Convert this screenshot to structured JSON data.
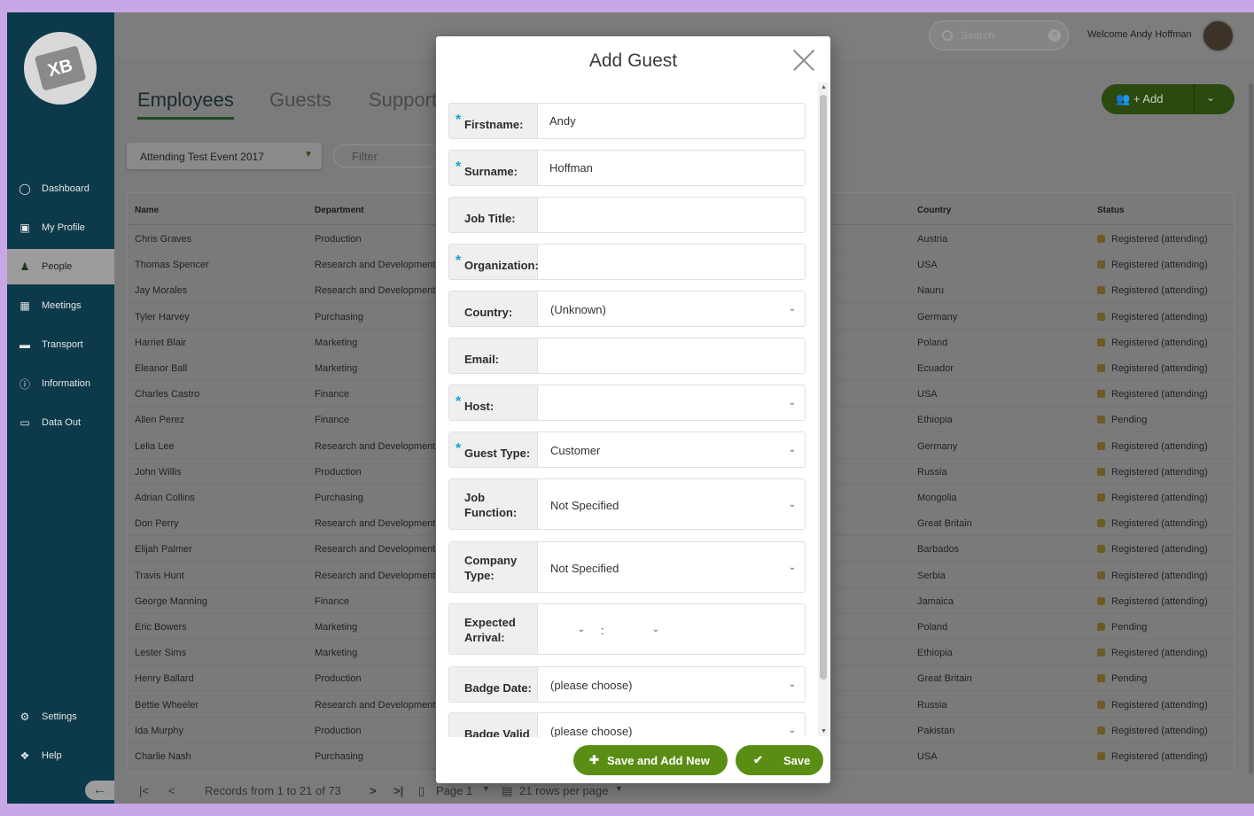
{
  "sidebar": {
    "logo_text": "XB",
    "items": [
      {
        "label": "Dashboard",
        "icon": "dashboard-icon"
      },
      {
        "label": "My Profile",
        "icon": "id-badge-icon"
      },
      {
        "label": "People",
        "icon": "person-icon"
      },
      {
        "label": "Meetings",
        "icon": "calendar-icon"
      },
      {
        "label": "Transport",
        "icon": "car-icon"
      },
      {
        "label": "Information",
        "icon": "info-icon"
      },
      {
        "label": "Data Out",
        "icon": "export-icon"
      }
    ],
    "bottom_items": [
      {
        "label": "Settings",
        "icon": "gear-icon"
      },
      {
        "label": "Help",
        "icon": "help-icon"
      }
    ]
  },
  "topbar": {
    "search_placeholder": "Search",
    "welcome": "Welcome Andy Hoffman"
  },
  "main": {
    "tabs": [
      "Employees",
      "Guests",
      "Support"
    ],
    "add_label": "+ Add",
    "event_select": "Attending Test Event 2017",
    "filter_placeholder": "Filter",
    "columns": {
      "name": "Name",
      "department": "Department",
      "country": "Country",
      "status": "Status"
    },
    "rows": [
      {
        "name": "Chris Graves",
        "department": "Production",
        "country": "Austria",
        "status": "Registered (attending)"
      },
      {
        "name": "Thomas Spencer",
        "department": "Research and Development",
        "country": "USA",
        "status": "Registered (attending)"
      },
      {
        "name": "Jay Morales",
        "department": "Research and Development",
        "country": "Nauru",
        "status": "Registered (attending)"
      },
      {
        "name": "Tyler Harvey",
        "department": "Purchasing",
        "country": "Germany",
        "status": "Registered (attending)"
      },
      {
        "name": "Harriet Blair",
        "department": "Marketing",
        "country": "Poland",
        "status": "Registered (attending)"
      },
      {
        "name": "Eleanor Ball",
        "department": "Marketing",
        "country": "Ecuador",
        "status": "Registered (attending)"
      },
      {
        "name": "Charles Castro",
        "department": "Finance",
        "country": "USA",
        "status": "Registered (attending)"
      },
      {
        "name": "Allen Perez",
        "department": "Finance",
        "country": "Ethiopia",
        "status": "Pending"
      },
      {
        "name": "Lelia Lee",
        "department": "Research and Development",
        "country": "Germany",
        "status": "Registered (attending)"
      },
      {
        "name": "John Willis",
        "department": "Production",
        "country": "Russia",
        "status": "Registered (attending)"
      },
      {
        "name": "Adrian Collins",
        "department": "Purchasing",
        "country": "Mongolia",
        "status": "Registered (attending)"
      },
      {
        "name": "Don Perry",
        "department": "Research and Development",
        "country": "Great Britain",
        "status": "Registered (attending)"
      },
      {
        "name": "Elijah Palmer",
        "department": "Research and Development",
        "country": "Barbados",
        "status": "Registered (attending)"
      },
      {
        "name": "Travis Hunt",
        "department": "Research and Development",
        "country": "Serbia",
        "status": "Registered (attending)"
      },
      {
        "name": "George Manning",
        "department": "Finance",
        "country": "Jamaica",
        "status": "Registered (attending)"
      },
      {
        "name": "Eric Bowers",
        "department": "Marketing",
        "country": "Poland",
        "status": "Pending"
      },
      {
        "name": "Lester Sims",
        "department": "Marketing",
        "country": "Ethiopia",
        "status": "Registered (attending)"
      },
      {
        "name": "Henry Ballard",
        "department": "Production",
        "country": "Great Britain",
        "status": "Pending"
      },
      {
        "name": "Bettie Wheeler",
        "department": "Research and Development",
        "country": "Russia",
        "status": "Registered (attending)"
      },
      {
        "name": "Ida Murphy",
        "department": "Production",
        "country": "Pakistan",
        "status": "Registered (attending)"
      },
      {
        "name": "Charlie Nash",
        "department": "Purchasing",
        "country": "USA",
        "status": "Registered (attending)"
      }
    ],
    "pager": {
      "records": "Records from 1 to 21 of 73",
      "page": "Page 1",
      "rows_per_page": "21 rows per page"
    }
  },
  "modal": {
    "title": "Add Guest",
    "fields": [
      {
        "label": "Firstname:",
        "required": true,
        "type": "text",
        "value": "Andy"
      },
      {
        "label": "Surname:",
        "required": true,
        "type": "text",
        "value": "Hoffman"
      },
      {
        "label": "Job Title:",
        "required": false,
        "type": "text",
        "value": ""
      },
      {
        "label": "Organization:",
        "required": true,
        "type": "text",
        "value": ""
      },
      {
        "label": "Country:",
        "required": false,
        "type": "select",
        "value": "(Unknown)"
      },
      {
        "label": "Email:",
        "required": false,
        "type": "text",
        "value": ""
      },
      {
        "label": "Host:",
        "required": true,
        "type": "select",
        "value": ""
      },
      {
        "label": "Guest Type:",
        "required": true,
        "type": "select",
        "value": "Customer"
      },
      {
        "label": "Job Function:",
        "required": false,
        "type": "select",
        "value": "Not Specified"
      },
      {
        "label": "Company Type:",
        "required": false,
        "type": "select",
        "value": "Not Specified"
      },
      {
        "label": "Expected Arrival:",
        "required": false,
        "type": "time",
        "value": ":"
      },
      {
        "label": "Badge Date:",
        "required": false,
        "type": "select",
        "value": "(please choose)"
      },
      {
        "label": "Badge Valid",
        "required": false,
        "type": "select",
        "value": "(please choose)"
      }
    ],
    "buttons": {
      "save_new": "Save and Add New",
      "save": "Save"
    }
  },
  "colors": {
    "sidebar": "#0c3a4a",
    "accent_green": "#5a8d14",
    "required_star": "#1a9fd4"
  }
}
